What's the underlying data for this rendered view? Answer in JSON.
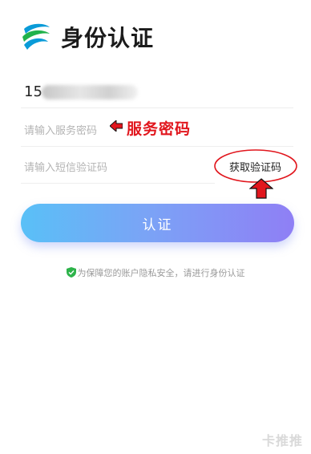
{
  "header": {
    "title": "身份认证"
  },
  "form": {
    "phone_prefix": "15",
    "password_placeholder": "请输入服务密码",
    "sms_placeholder": "请输入短信验证码",
    "get_code_label": "获取验证码",
    "submit_label": "认证"
  },
  "annotation": {
    "password_label": "服务密码"
  },
  "notice": {
    "text": "为保障您的账户隐私安全，请进行身份认证"
  },
  "watermark": {
    "text": "卡推推"
  },
  "colors": {
    "accent_start": "#59c0f7",
    "accent_end": "#8f7ff5",
    "annotation_red": "#e1161d"
  }
}
